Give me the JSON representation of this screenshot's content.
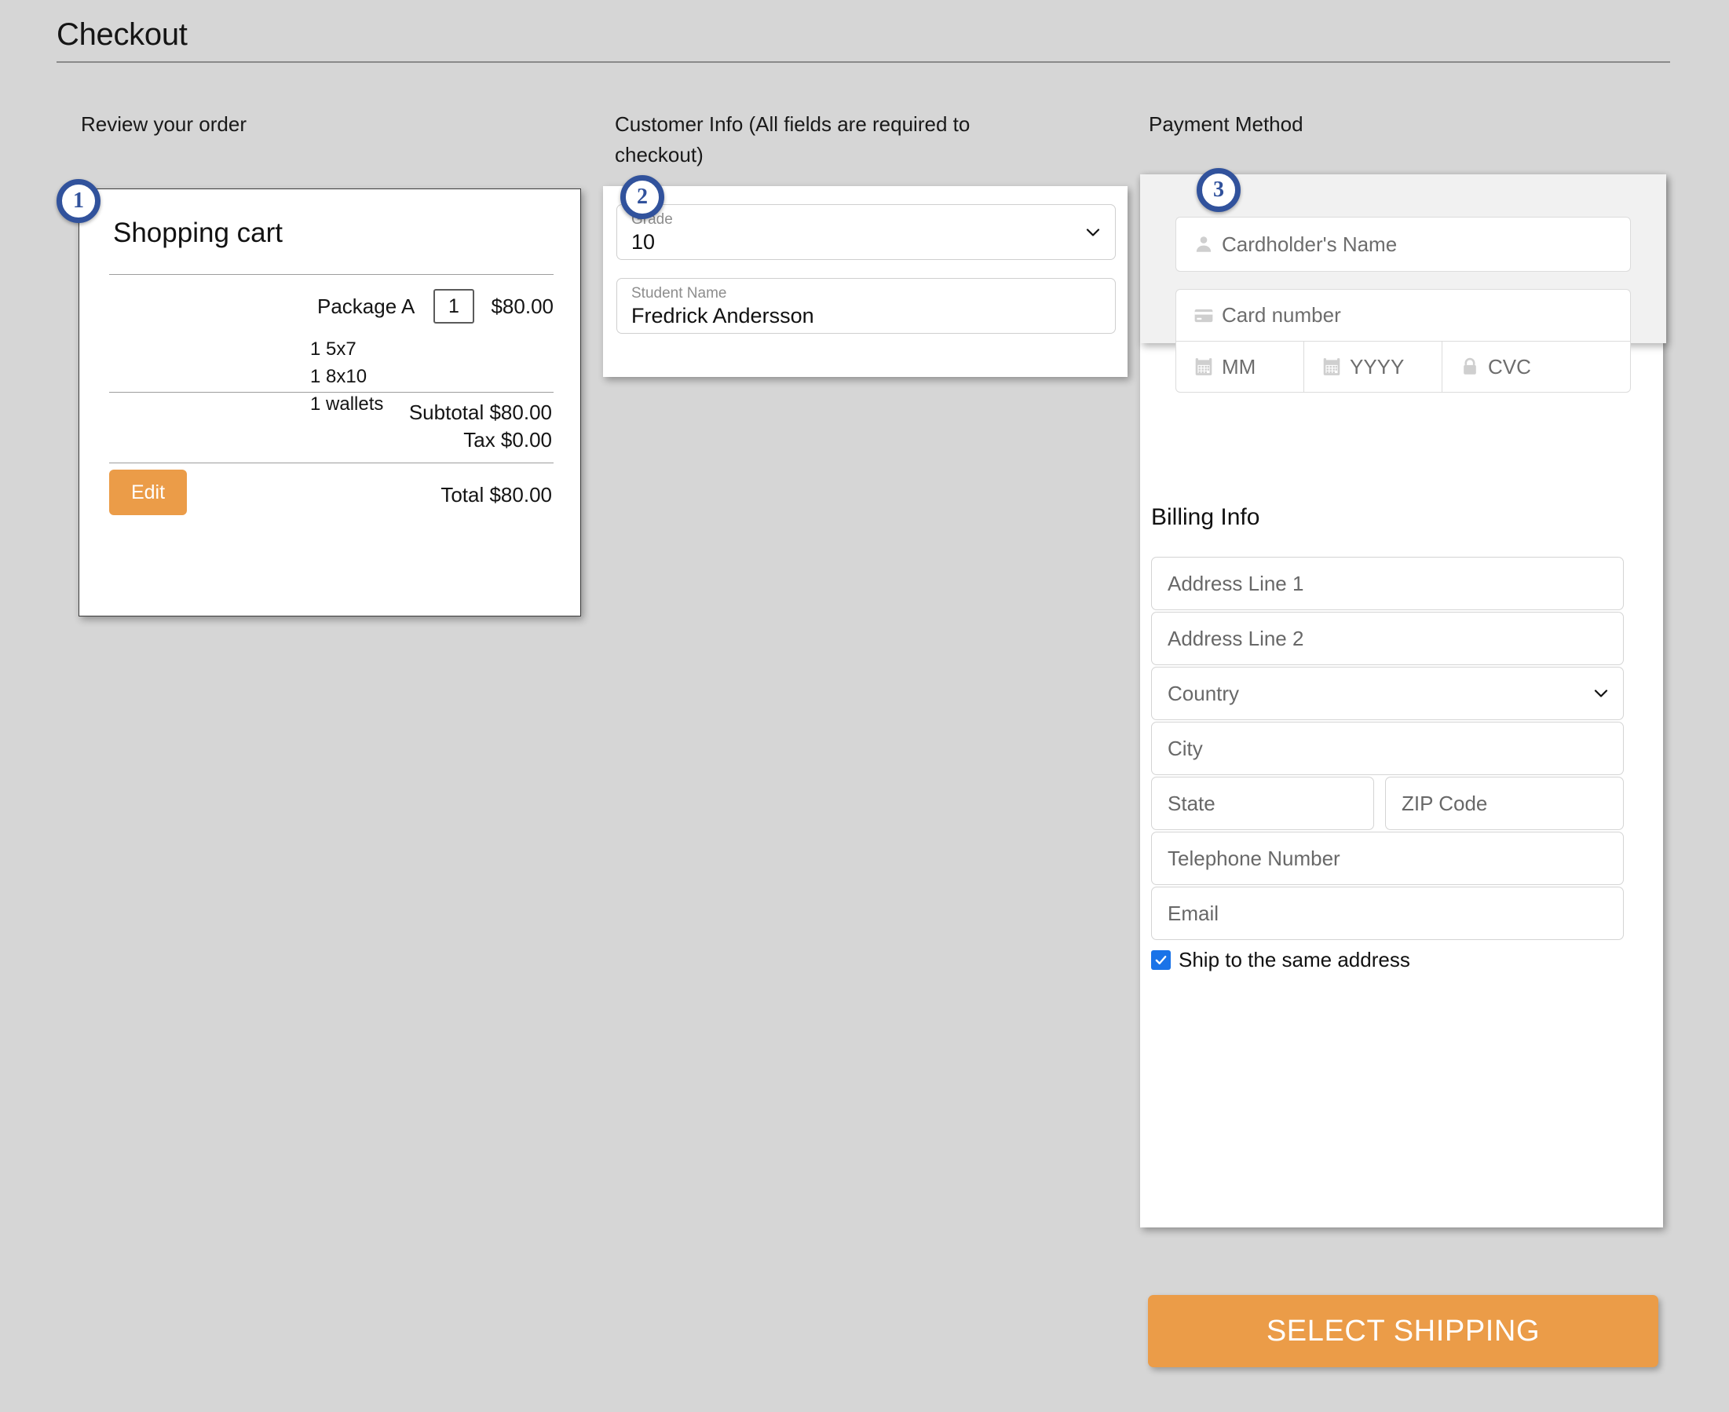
{
  "page": {
    "title": "Checkout",
    "background_color": "#d6d6d6",
    "accent_orange": "#eb9c48",
    "badge_blue": "#31529c",
    "checkbox_blue": "#1a73e8"
  },
  "columns": {
    "review_heading": "Review your order",
    "customer_heading": "Customer Info (All fields are required to checkout)",
    "payment_heading": "Payment Method"
  },
  "steps": {
    "one": "1",
    "two": "2",
    "three": "3"
  },
  "cart": {
    "title": "Shopping cart",
    "item_name": "Package A",
    "item_quantity": "1",
    "item_price": "$80.00",
    "contents": [
      "1 5x7",
      "1 8x10",
      "1 wallets"
    ],
    "subtotal": "Subtotal $80.00",
    "tax": "Tax $0.00",
    "total": "Total $80.00",
    "edit_label": "Edit"
  },
  "customer": {
    "grade_label": "Grade",
    "grade_value": "10",
    "student_label": "Student Name",
    "student_value": "Fredrick Andersson"
  },
  "payment": {
    "cardholder_placeholder": "Cardholder's Name",
    "card_number_placeholder": "Card number",
    "month_placeholder": "MM",
    "year_placeholder": "YYYY",
    "cvc_placeholder": "CVC"
  },
  "billing": {
    "title": "Billing Info",
    "address1_placeholder": "Address Line 1",
    "address2_placeholder": "Address Line 2",
    "country_placeholder": "Country",
    "city_placeholder": "City",
    "state_placeholder": "State",
    "zip_placeholder": "ZIP Code",
    "telephone_placeholder": "Telephone Number",
    "email_placeholder": "Email",
    "ship_same_label": "Ship to the same address",
    "ship_same_checked": true
  },
  "actions": {
    "select_shipping_label": "SELECT SHIPPING"
  }
}
